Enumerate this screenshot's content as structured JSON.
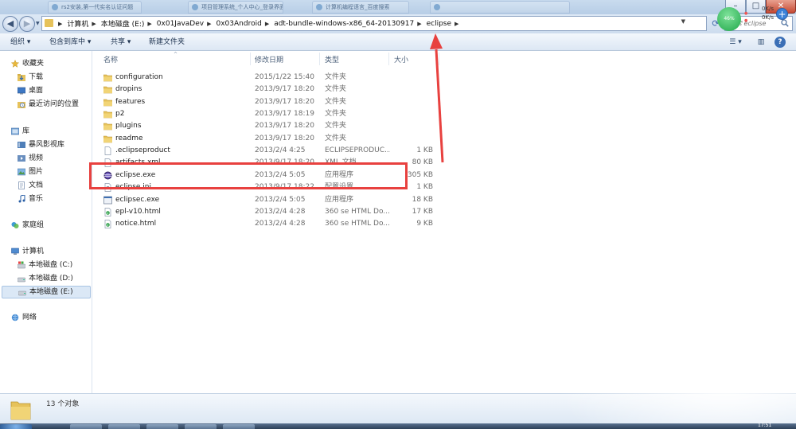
{
  "window": {
    "bg_tabs": [
      "rs2安装,第一代实名认证问题",
      "项目管理系统_个人中心_登录界面",
      "计算机编程语言_百度搜索"
    ],
    "controls": {
      "minimize": "–",
      "maximize": "□",
      "close": "✕"
    }
  },
  "address_bar": {
    "crumbs": [
      "计算机",
      "本地磁盘 (E:)",
      "0x01JavaDev",
      "0x03Android",
      "adt-bundle-windows-x86_64-20130917",
      "eclipse"
    ],
    "search_placeholder": "搜索 eclipse"
  },
  "toolbar": {
    "organize": "组织 ▾",
    "include_library": "包含到库中 ▾",
    "share": "共享 ▾",
    "new_folder": "新建文件夹",
    "view_icon": "☰ ▾",
    "pane_icon": "▥",
    "help_icon": "?"
  },
  "sidebar": {
    "favorites": {
      "label": "收藏夹",
      "items": [
        "下载",
        "桌面",
        "最近访问的位置"
      ]
    },
    "libraries": {
      "label": "库",
      "items": [
        "暴风影视库",
        "视频",
        "图片",
        "文档",
        "音乐"
      ]
    },
    "homegroup": "家庭组",
    "computer": {
      "label": "计算机",
      "items": [
        "本地磁盘 (C:)",
        "本地磁盘 (D:)",
        "本地磁盘 (E:)"
      ]
    },
    "network": "网络"
  },
  "columns": {
    "name": "名称",
    "date": "修改日期",
    "type": "类型",
    "size": "大小"
  },
  "files": [
    {
      "name": "configuration",
      "date": "2015/1/22 15:40",
      "type": "文件夹",
      "size": "",
      "kind": "folder"
    },
    {
      "name": "dropins",
      "date": "2013/9/17 18:20",
      "type": "文件夹",
      "size": "",
      "kind": "folder"
    },
    {
      "name": "features",
      "date": "2013/9/17 18:20",
      "type": "文件夹",
      "size": "",
      "kind": "folder"
    },
    {
      "name": "p2",
      "date": "2013/9/17 18:19",
      "type": "文件夹",
      "size": "",
      "kind": "folder"
    },
    {
      "name": "plugins",
      "date": "2013/9/17 18:20",
      "type": "文件夹",
      "size": "",
      "kind": "folder"
    },
    {
      "name": "readme",
      "date": "2013/9/17 18:20",
      "type": "文件夹",
      "size": "",
      "kind": "folder"
    },
    {
      "name": ".eclipseproduct",
      "date": "2013/2/4 4:25",
      "type": "ECLIPSEPRODUC...",
      "size": "1 KB",
      "kind": "file"
    },
    {
      "name": "artifacts.xml",
      "date": "2013/9/17 18:20",
      "type": "XML 文档",
      "size": "80 KB",
      "kind": "xml"
    },
    {
      "name": "eclipse.exe",
      "date": "2013/2/4 5:05",
      "type": "应用程序",
      "size": "305 KB",
      "kind": "eclipse"
    },
    {
      "name": "eclipse.ini",
      "date": "2013/9/17 18:22",
      "type": "配置设置",
      "size": "1 KB",
      "kind": "ini"
    },
    {
      "name": "eclipsec.exe",
      "date": "2013/2/4 5:05",
      "type": "应用程序",
      "size": "18 KB",
      "kind": "exe"
    },
    {
      "name": "epl-v10.html",
      "date": "2013/2/4 4:28",
      "type": "360 se HTML Do...",
      "size": "17 KB",
      "kind": "html"
    },
    {
      "name": "notice.html",
      "date": "2013/2/4 4:28",
      "type": "360 se HTML Do...",
      "size": "9 KB",
      "kind": "html"
    }
  ],
  "status": {
    "count": "13 个对象"
  },
  "net_widget": {
    "percent": "46%",
    "up": "0K/s",
    "down": "0K/s",
    "plus": "+"
  },
  "taskbar": {
    "clock": "17:51"
  },
  "colors": {
    "annotation_red": "#e8413f",
    "folder": "#e6c25b",
    "accent": "#3b82d8"
  }
}
